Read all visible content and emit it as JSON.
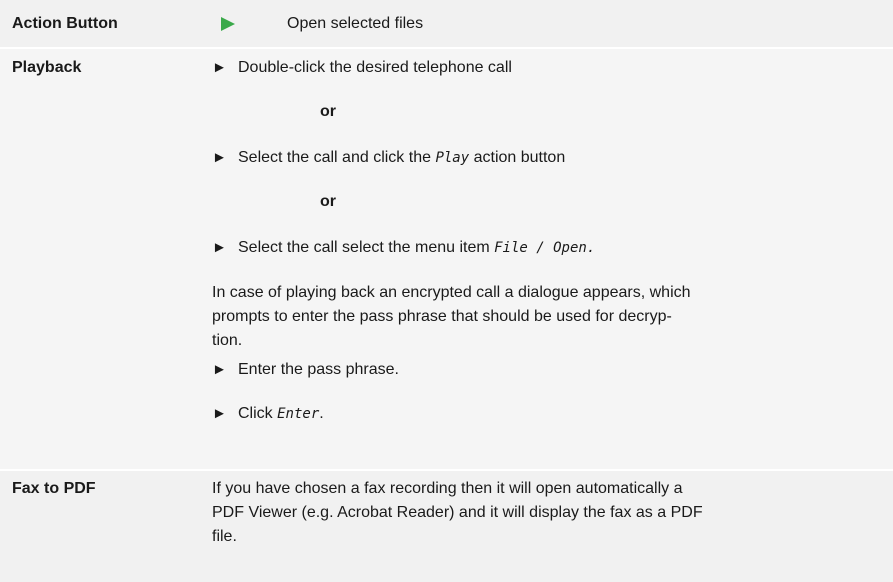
{
  "rows": {
    "action": {
      "label": "Action Button",
      "text": "Open selected files",
      "icon": "play-triangle-icon",
      "icon_color": "#3aa94a"
    },
    "playback": {
      "label": "Playback",
      "bullet": "►",
      "step1": "Double-click the desired telephone call",
      "or1": "or",
      "step2_before": "Select the call and click the ",
      "step2_code": "Play",
      "step2_after": " action button",
      "or2": "or",
      "step3_before": "Select the call select the menu item ",
      "step3_code": "File / Open.",
      "para_line1": "In case of playing back an encrypted call a dialogue appears, which",
      "para_line2": "prompts to enter the pass phrase that should be used for decryp-",
      "para_line3": "tion.",
      "step4": "Enter the pass phrase.",
      "step5_before": "Click ",
      "step5_code": "Enter",
      "step5_after": "."
    },
    "fax": {
      "label": "Fax to PDF",
      "line1": "If you have chosen a fax recording then it will open automatically a",
      "line2": "PDF Viewer (e.g. Acrobat Reader) and it will display the fax as a PDF",
      "line3": "file."
    }
  }
}
